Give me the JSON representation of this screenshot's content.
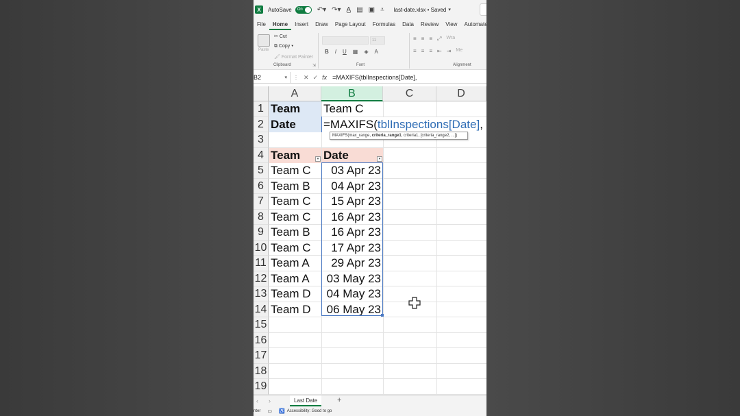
{
  "titlebar": {
    "autosave_label": "AutoSave",
    "autosave_state": "On",
    "filename": "last-date.xlsx • Saved"
  },
  "menu": {
    "tabs": [
      "File",
      "Home",
      "Insert",
      "Draw",
      "Page Layout",
      "Formulas",
      "Data",
      "Review",
      "View",
      "Automate"
    ],
    "active": "Home"
  },
  "ribbon": {
    "paste": "Paste",
    "cut": "Cut",
    "copy": "Copy",
    "format_painter": "Format Painter",
    "clipboard_label": "Clipboard",
    "font_label": "Font",
    "font_size": "11",
    "alignment_label": "Alignment",
    "wrap": "Wra",
    "merge": "Me"
  },
  "formula_bar": {
    "name_box": "B2",
    "formula": "=MAXIFS(tblInspections[Date],"
  },
  "columns": [
    "A",
    "B",
    "C",
    "D"
  ],
  "rows": [
    "1",
    "2",
    "3",
    "4",
    "5",
    "6",
    "7",
    "8",
    "9",
    "10",
    "11",
    "12",
    "13",
    "14",
    "15",
    "16",
    "17",
    "18",
    "19"
  ],
  "cells": {
    "a1": "Team",
    "b1": "Team C",
    "a2": "Date",
    "b2_prefix": "=MAXIFS(",
    "b2_ref": "tblInspections[Date]",
    "b2_suffix": ","
  },
  "tooltip": {
    "before": "MAXIFS(max_range, ",
    "bold": "criteria_range1",
    "after": ", criteria1, [criteria_range2, ...])"
  },
  "table": {
    "headers": [
      "Team",
      "Date"
    ],
    "rows": [
      [
        "Team C",
        "03 Apr 23"
      ],
      [
        "Team B",
        "04 Apr 23"
      ],
      [
        "Team C",
        "15 Apr 23"
      ],
      [
        "Team C",
        "16 Apr 23"
      ],
      [
        "Team B",
        "16 Apr 23"
      ],
      [
        "Team C",
        "17 Apr 23"
      ],
      [
        "Team A",
        "29 Apr 23"
      ],
      [
        "Team A",
        "03 May 23"
      ],
      [
        "Team D",
        "04 May 23"
      ],
      [
        "Team D",
        "06 May 23"
      ]
    ]
  },
  "sheet": {
    "tab_name": "Last Date",
    "add": "+"
  },
  "status": {
    "mode": "nter",
    "accessibility": "Accessibility: Good to go"
  },
  "colors": {
    "excel_green": "#107c41",
    "selection_blue": "#4a78c2",
    "input_fill": "#dde8f5",
    "header_fill": "#f9dcd5"
  }
}
